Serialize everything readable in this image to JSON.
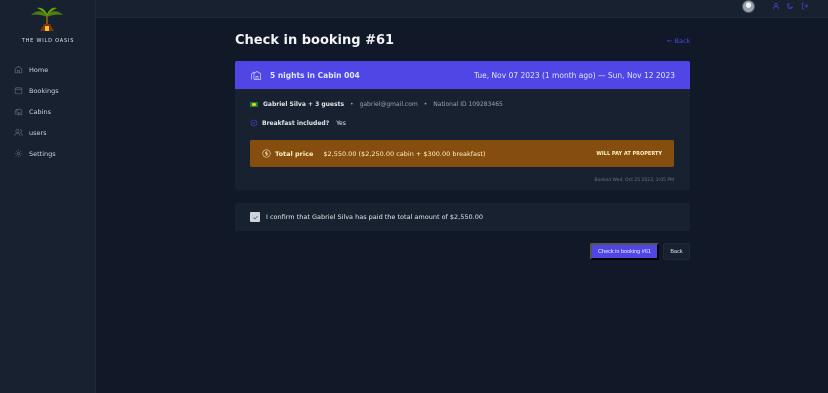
{
  "brand": {
    "name": "THE WILD OASIS"
  },
  "sidebar": {
    "items": [
      {
        "label": "Home",
        "icon": "home-icon"
      },
      {
        "label": "Bookings",
        "icon": "calendar-icon"
      },
      {
        "label": "Cabins",
        "icon": "cabin-icon"
      },
      {
        "label": "users",
        "icon": "users-icon"
      },
      {
        "label": "Settings",
        "icon": "gear-icon"
      }
    ]
  },
  "header": {
    "icons": [
      "avatar",
      "user-icon",
      "moon-icon",
      "logout-icon"
    ]
  },
  "page": {
    "title": "Check in booking #61",
    "back_link": "← Back"
  },
  "booking": {
    "nights_cabin": "5 nights in Cabin",
    "cabin_number": "004",
    "date_range": "Tue, Nov 07 2023 (1 month ago) — Sun, Nov 12 2023",
    "guest_name": "Gabriel Silva + 3 guests",
    "email": "gabriel@gmail.com",
    "national_id": "National ID 109283465",
    "breakfast_label": "Breakfast included?",
    "breakfast_value": "Yes",
    "price_label": "Total price",
    "price_value": "$2,550.00 ($2,250.00 cabin + $300.00 breakfast)",
    "pay_status": "WILL PAY AT PROPERTY",
    "booked_on": "Booked Wed, Oct 25 2023, 3:05 PM"
  },
  "confirm": {
    "text": "I confirm that Gabriel Silva has paid the total amount of $2,550.00",
    "checked": true
  },
  "actions": {
    "check_in": "Check in booking #61",
    "back": "Back"
  },
  "colors": {
    "accent": "#4f46e5",
    "price_bg": "#854d0e",
    "background": "#111827",
    "panel": "#18212f"
  }
}
